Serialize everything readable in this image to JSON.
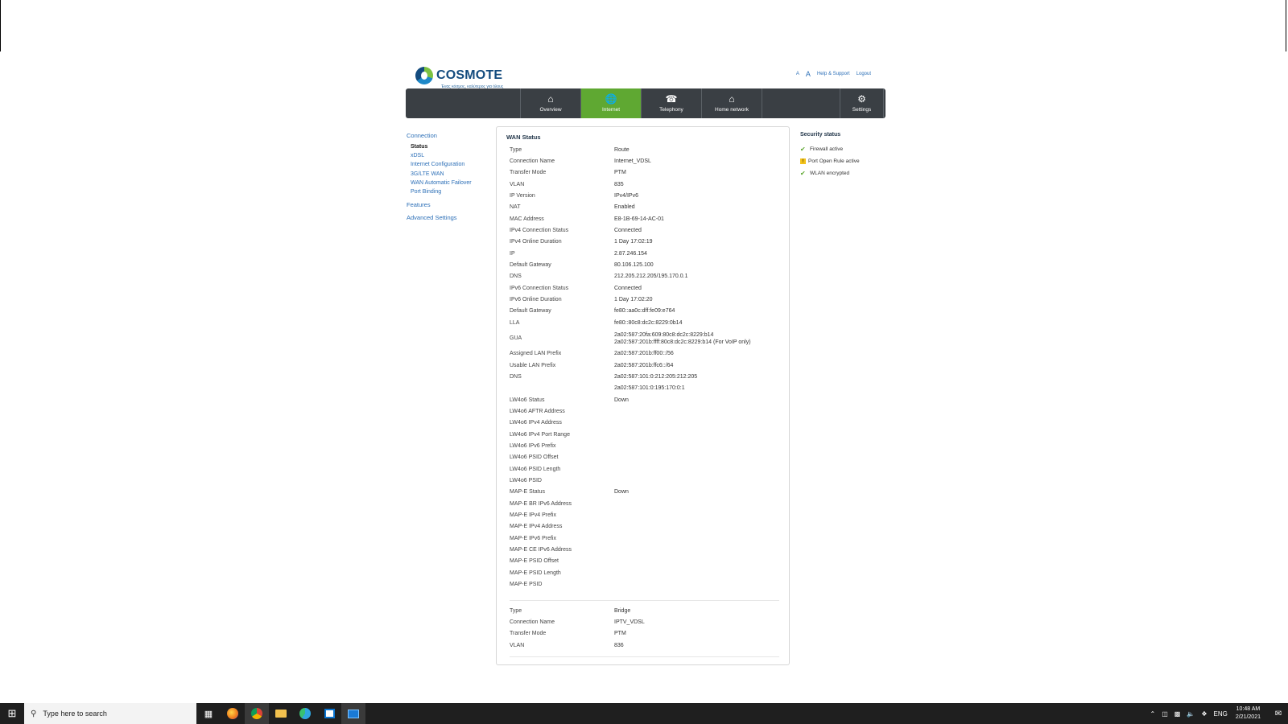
{
  "brand": {
    "name": "COSMOTE",
    "tagline": "Ένας κόσμος, καλύτερος για όλους"
  },
  "header_links": {
    "font_small": "A",
    "font_large": "A",
    "help": "Help & Support",
    "logout": "Logout"
  },
  "nav": {
    "items": [
      {
        "label": "Overview",
        "icon": "home-icon"
      },
      {
        "label": "Internet",
        "icon": "globe-icon"
      },
      {
        "label": "Telephony",
        "icon": "phone-icon"
      },
      {
        "label": "Home network",
        "icon": "house-network-icon"
      },
      {
        "label": "Settings",
        "icon": "gear-icon"
      }
    ],
    "active": "Internet"
  },
  "sidebar": {
    "connection": "Connection",
    "items": [
      "Status",
      "xDSL",
      "Internet Configuration",
      "3G/LTE WAN",
      "WAN Automatic Failover",
      "Port Binding"
    ],
    "selected": "Status",
    "features": "Features",
    "advanced": "Advanced Settings"
  },
  "wan": {
    "title": "WAN Status",
    "rows": [
      {
        "k": "Type",
        "v": "Route"
      },
      {
        "k": "Connection Name",
        "v": "Internet_VDSL"
      },
      {
        "k": "Transfer Mode",
        "v": "PTM"
      },
      {
        "k": "VLAN",
        "v": "835"
      },
      {
        "k": "IP Version",
        "v": "IPv4/IPv6"
      },
      {
        "k": "NAT",
        "v": "Enabled"
      },
      {
        "k": "MAC Address",
        "v": "E8-1B-69-14-AC-01"
      },
      {
        "k": "IPv4 Connection Status",
        "v": "Connected"
      },
      {
        "k": "IPv4 Online Duration",
        "v": "1 Day 17:02:19"
      },
      {
        "k": "IP",
        "v": "2.87.246.154"
      },
      {
        "k": "Default Gateway",
        "v": "80.106.125.100"
      },
      {
        "k": "DNS",
        "v": "212.205.212.205/195.170.0.1"
      },
      {
        "k": "IPv6 Connection Status",
        "v": "Connected"
      },
      {
        "k": "IPv6 Online Duration",
        "v": "1 Day 17:02:20"
      },
      {
        "k": "Default Gateway",
        "v": "fe80::aa0c:dff:fe09:e764"
      },
      {
        "k": "LLA",
        "v": "fe80::80c8:dc2c:8229:0b14"
      },
      {
        "k": "GUA",
        "v": "2a02:587:20fa:609:80c8:dc2c:8229:b14",
        "v2": "2a02:587:201b:ffff:80c8:dc2c:8229:b14 (For VoIP only)"
      },
      {
        "k": "Assigned LAN Prefix",
        "v": "2a02:587:201b:ff00::/56"
      },
      {
        "k": "Usable LAN Prefix",
        "v": "2a02:587:201b:ffc6::/64"
      },
      {
        "k": "DNS",
        "v": "2a02:587:101:0:212:205:212:205"
      },
      {
        "k": "",
        "v": "2a02:587:101:0:195:170:0:1"
      },
      {
        "k": "LW4o6 Status",
        "v": "Down"
      },
      {
        "k": "LW4o6 AFTR Address",
        "v": ""
      },
      {
        "k": "LW4o6 IPv4 Address",
        "v": ""
      },
      {
        "k": "LW4o6 IPv4 Port Range",
        "v": ""
      },
      {
        "k": "LW4o6 IPv6 Prefix",
        "v": ""
      },
      {
        "k": "LW4o6 PSID Offset",
        "v": ""
      },
      {
        "k": "LW4o6 PSID Length",
        "v": ""
      },
      {
        "k": "LW4o6 PSID",
        "v": ""
      },
      {
        "k": "MAP-E Status",
        "v": "Down"
      },
      {
        "k": "MAP-E BR IPv6 Address",
        "v": ""
      },
      {
        "k": "MAP-E IPv4 Prefix",
        "v": ""
      },
      {
        "k": "MAP-E IPv4 Address",
        "v": ""
      },
      {
        "k": "MAP-E IPv6 Prefix",
        "v": ""
      },
      {
        "k": "MAP-E CE IPv6 Address",
        "v": ""
      },
      {
        "k": "MAP-E PSID Offset",
        "v": ""
      },
      {
        "k": "MAP-E PSID Length",
        "v": ""
      },
      {
        "k": "MAP-E PSID",
        "v": ""
      }
    ],
    "rows2": [
      {
        "k": "Type",
        "v": "Bridge"
      },
      {
        "k": "Connection Name",
        "v": "IPTV_VDSL"
      },
      {
        "k": "Transfer Mode",
        "v": "PTM"
      },
      {
        "k": "VLAN",
        "v": "836"
      }
    ]
  },
  "security": {
    "title": "Security status",
    "items": [
      {
        "label": "Firewall active",
        "state": "ok"
      },
      {
        "label": "Port Open Rule active",
        "state": "warn"
      },
      {
        "label": "WLAN encrypted",
        "state": "ok"
      }
    ]
  },
  "taskbar": {
    "search_placeholder": "Type here to search",
    "apps": [
      "task-view-icon",
      "firefox-icon",
      "chrome-icon",
      "file-explorer-icon",
      "edge-icon",
      "store-icon",
      "photos-icon"
    ],
    "lang": "ENG",
    "time": "10:48 AM",
    "date": "2/21/2021"
  }
}
